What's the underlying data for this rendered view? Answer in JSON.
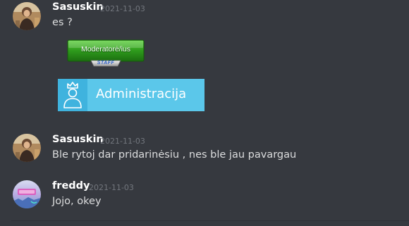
{
  "colors": {
    "background": "#36393f",
    "username": "#ffffff",
    "timestamp": "#72767d",
    "text": "#dcddde",
    "moderator_badge_green": "#2e9a1c",
    "admin_banner_blue": "#5bc7ea"
  },
  "messages": [
    {
      "author": "Sasuskin",
      "timestamp": "2021-11-03",
      "avatar_icon": "user-avatar-photo-icon",
      "text": "es ?",
      "images": [
        {
          "icon": "moderator-badge-image",
          "label": "Moderatorė/ius",
          "sublabel": "STAFF"
        },
        {
          "icon": "administracija-banner-image",
          "label": "Administracija"
        }
      ]
    },
    {
      "author": "Sasuskin",
      "timestamp": "2021-11-03",
      "avatar_icon": "user-avatar-photo-icon",
      "text": "Ble rytoj dar pridarinėsiu , nes ble jau pavargau"
    },
    {
      "author": "freddy",
      "timestamp": "2021-11-03",
      "avatar_icon": "user-avatar-neon-icon",
      "text": "Jojo, okey"
    }
  ]
}
